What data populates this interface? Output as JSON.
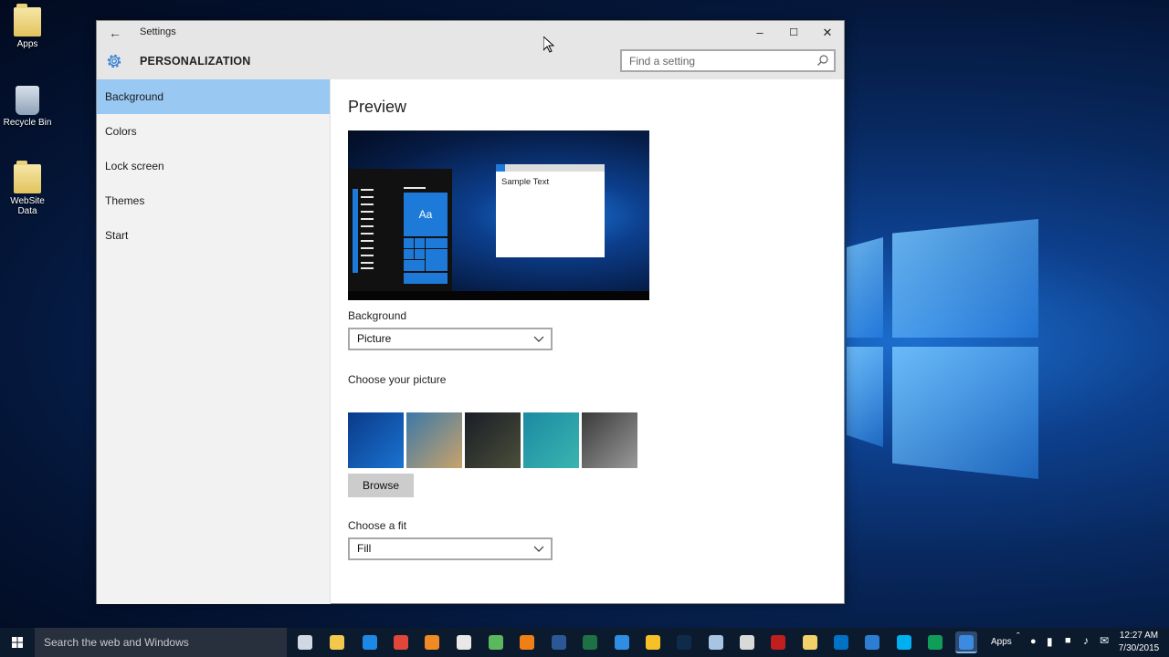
{
  "desktop": {
    "icons": [
      {
        "label": "Apps"
      },
      {
        "label": "Recycle Bin"
      },
      {
        "label": "WebSite Data"
      }
    ]
  },
  "window": {
    "title": "Settings",
    "section": "PERSONALIZATION",
    "search_placeholder": "Find a setting",
    "controls": {
      "minimize": "–",
      "maximize": "☐",
      "close": "✕"
    }
  },
  "sidebar": {
    "items": [
      {
        "label": "Background",
        "active": true
      },
      {
        "label": "Colors",
        "active": false
      },
      {
        "label": "Lock screen",
        "active": false
      },
      {
        "label": "Themes",
        "active": false
      },
      {
        "label": "Start",
        "active": false
      }
    ]
  },
  "main": {
    "preview_heading": "Preview",
    "preview": {
      "tile_text": "Aa",
      "sample_text": "Sample Text"
    },
    "background_label": "Background",
    "background_value": "Picture",
    "choose_picture_label": "Choose your picture",
    "browse_label": "Browse",
    "fit_label": "Choose a fit",
    "fit_value": "Fill",
    "thumbnails": [
      {
        "name": "windows-hero",
        "colors": [
          "#0a3a8a",
          "#1a73d0"
        ]
      },
      {
        "name": "beach-rocks",
        "colors": [
          "#3b78a8",
          "#c9a36a"
        ]
      },
      {
        "name": "night-sky",
        "colors": [
          "#1a1d26",
          "#4a4f3a"
        ]
      },
      {
        "name": "underwater",
        "colors": [
          "#1c8aa3",
          "#39b5b0"
        ]
      },
      {
        "name": "rock-wall",
        "colors": [
          "#3a3a3a",
          "#9a9a9a"
        ]
      }
    ]
  },
  "taskbar": {
    "search_placeholder": "Search the web and Windows",
    "apps_label": "Apps",
    "apps": [
      {
        "name": "task-view-icon",
        "color": "#cfd8e3"
      },
      {
        "name": "file-explorer-icon",
        "color": "#f2c94c"
      },
      {
        "name": "edge-icon",
        "color": "#1e88e5"
      },
      {
        "name": "chrome-icon",
        "color": "#e0463a"
      },
      {
        "name": "firefox-icon",
        "color": "#f08a24"
      },
      {
        "name": "store-icon",
        "color": "#e8e8e8"
      },
      {
        "name": "utorrent-icon",
        "color": "#5cb85c"
      },
      {
        "name": "vlc-icon",
        "color": "#f07f16"
      },
      {
        "name": "word-icon",
        "color": "#2b5797"
      },
      {
        "name": "excel-icon",
        "color": "#1e7145"
      },
      {
        "name": "dropbox-icon",
        "color": "#2f8de4"
      },
      {
        "name": "google-drive-icon",
        "color": "#f6c026"
      },
      {
        "name": "photoshop-icon",
        "color": "#0e2c4a"
      },
      {
        "name": "notepad-icon",
        "color": "#a7c5e2"
      },
      {
        "name": "paint-icon",
        "color": "#d9d9d9"
      },
      {
        "name": "filezilla-icon",
        "color": "#bf1f1f"
      },
      {
        "name": "folder-icon",
        "color": "#f2d16b"
      },
      {
        "name": "outlook-icon",
        "color": "#0072c6"
      },
      {
        "name": "remote-desktop-icon",
        "color": "#2d7dd2"
      },
      {
        "name": "skype-icon",
        "color": "#00aff0"
      },
      {
        "name": "hangouts-icon",
        "color": "#0f9d58"
      },
      {
        "name": "settings-icon",
        "color": "#3d8be0"
      }
    ],
    "clock_time": "12:27 AM",
    "clock_date": "7/30/2015"
  },
  "colors": {
    "accent": "#1e7ad8",
    "nav_active": "#99c8f2",
    "titlebar": "#e6e6e6"
  }
}
